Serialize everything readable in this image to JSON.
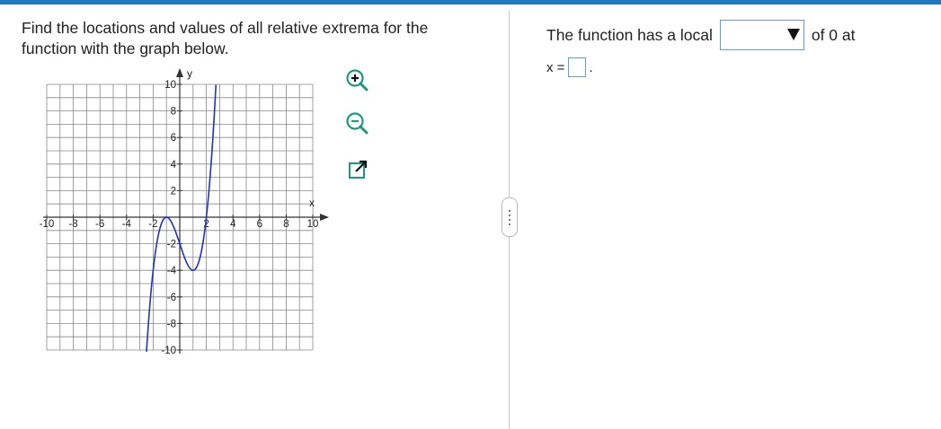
{
  "question": {
    "text": "Find the locations and values of all relative extrema for the function with the graph below."
  },
  "graph": {
    "x_axis_label": "x",
    "y_axis_label": "y",
    "x_tick_labels": [
      "-10",
      "-8",
      "-6",
      "-4",
      "-2",
      "2",
      "4",
      "6",
      "8",
      "10"
    ],
    "y_tick_labels": [
      "10",
      "8",
      "6",
      "4",
      "2",
      "-2",
      "-4",
      "-6",
      "-8",
      "-10"
    ],
    "curve_color": "#2233bb",
    "grid_color": "#888888"
  },
  "tools": {
    "zoom_in": "zoom-in-icon",
    "zoom_out": "zoom-out-icon",
    "popout": "external-link-icon",
    "icon_color": "#1a9a7a"
  },
  "answer": {
    "prefix": "The function has a local",
    "select_value": "",
    "suffix": "of 0 at",
    "x_label": "x =",
    "x_value": "",
    "period": "."
  }
}
